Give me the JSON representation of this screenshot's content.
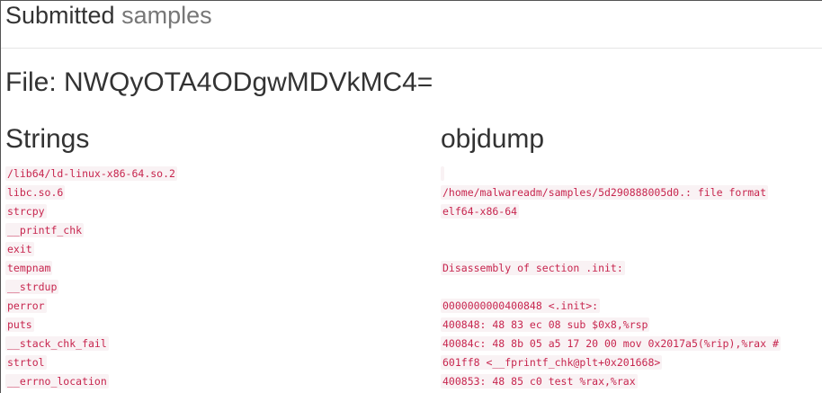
{
  "page": {
    "title_main": "Submitted",
    "title_sub": "samples",
    "file_heading": "File: NWQyOTA4ODgwMDVkMC4="
  },
  "strings": {
    "heading": "Strings",
    "items": [
      "/lib64/ld-linux-x86-64.so.2",
      "libc.so.6",
      "strcpy",
      "__printf_chk",
      "exit",
      "tempnam",
      "__strdup",
      "perror",
      "puts",
      "__stack_chk_fail",
      "strtol",
      "__errno_location"
    ]
  },
  "objdump": {
    "heading": "objdump",
    "lines": [
      "",
      "/home/malwareadm/samples/5d290888005d0.: file format",
      "elf64-x86-64",
      "",
      "",
      "Disassembly of section .init:",
      "",
      "0000000000400848 <.init>:",
      "400848: 48 83 ec 08 sub $0x8,%rsp",
      "40084c: 48 8b 05 a5 17 20 00 mov 0x2017a5(%rip),%rax #",
      "601ff8 <__fprintf_chk@plt+0x201668>",
      "400853: 48 85 c0 test %rax,%rax"
    ]
  }
}
